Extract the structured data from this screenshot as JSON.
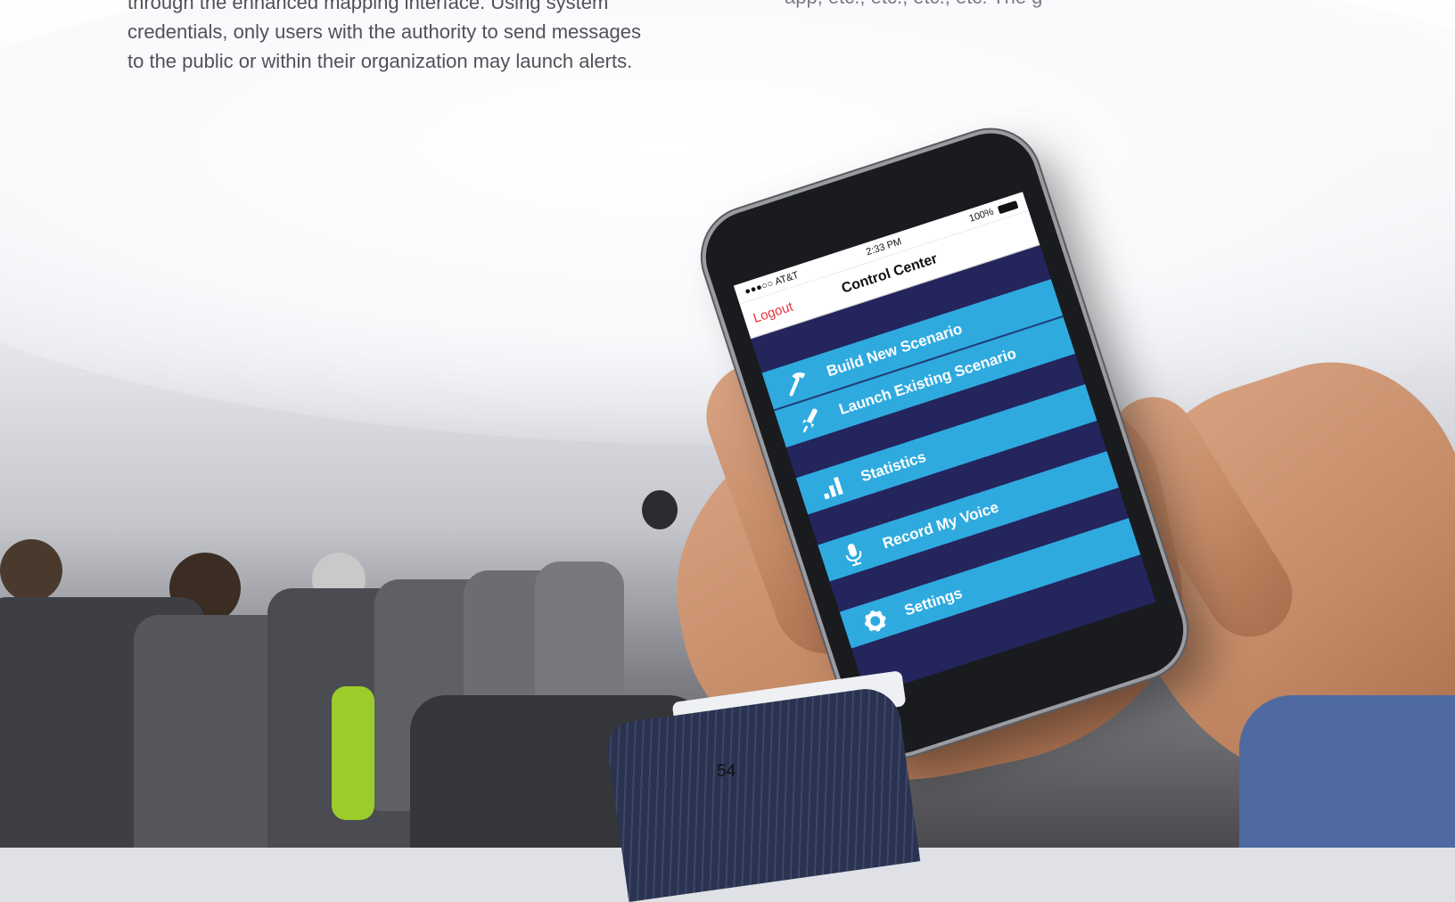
{
  "article": {
    "left_lines": [
      "through the enhanced mapping interface. Using system",
      "credentials, only users with the authority to send messages",
      "to the public or within their organization may launch alerts."
    ],
    "right_fragment": "app, etc., etc., etc., etc. The g"
  },
  "phone": {
    "status": {
      "carrier": "●●●○○ AT&T",
      "time": "2:33 PM",
      "battery": "100%"
    },
    "nav": {
      "logout": "Logout",
      "title": "Control Center"
    },
    "menu": [
      {
        "label": "Build New Scenario",
        "icon": "hammer-icon"
      },
      {
        "label": "Launch Existing Scenario",
        "icon": "rocket-icon"
      },
      {
        "label": "Statistics",
        "icon": "bar-chart-icon"
      },
      {
        "label": "Record My Voice",
        "icon": "microphone-icon"
      },
      {
        "label": "Settings",
        "icon": "gear-icon"
      }
    ],
    "colors": {
      "background": "#23255c",
      "item": "#2faadf",
      "logout": "#e8323c"
    }
  },
  "page_number": "54"
}
